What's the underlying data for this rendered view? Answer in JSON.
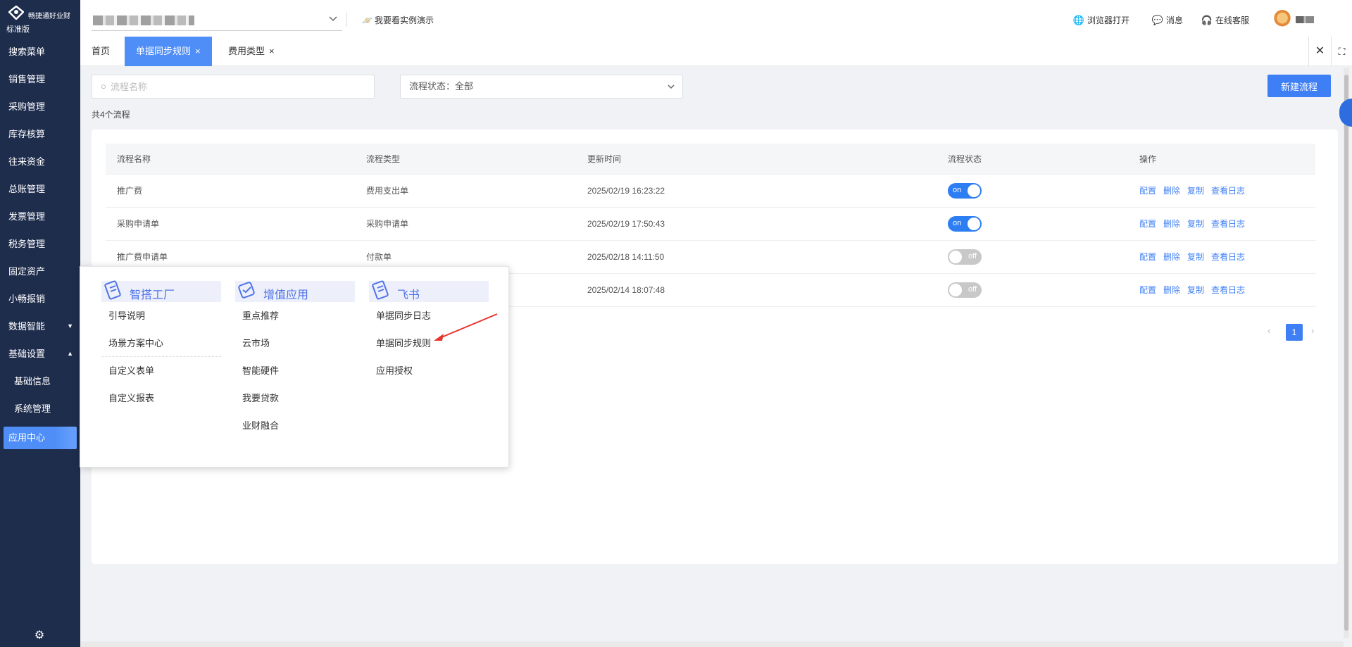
{
  "brand": {
    "name": "畅捷通好业财",
    "edition": "标准版"
  },
  "sidebar": {
    "items": [
      {
        "label": "搜索菜单"
      },
      {
        "label": "销售管理"
      },
      {
        "label": "采购管理"
      },
      {
        "label": "库存核算"
      },
      {
        "label": "往来资金"
      },
      {
        "label": "总账管理"
      },
      {
        "label": "发票管理"
      },
      {
        "label": "税务管理"
      },
      {
        "label": "固定资产"
      },
      {
        "label": "小畅报销"
      },
      {
        "label": "数据智能",
        "caret": "▼"
      },
      {
        "label": "基础设置",
        "caret": "▲"
      },
      {
        "label": "基础信息"
      },
      {
        "label": "系统管理"
      },
      {
        "label": "应用中心"
      }
    ],
    "gear_icon": "gear-icon"
  },
  "header": {
    "demo_link": "我要看实例演示",
    "browser_open": "浏览器打开",
    "messages": "消息",
    "support": "在线客服"
  },
  "tabs": {
    "items": [
      {
        "label": "首页"
      },
      {
        "label": "单据同步规则",
        "close": "×"
      },
      {
        "label": "费用类型",
        "close": "×"
      }
    ],
    "close_all": "✕",
    "fullscreen": "⛶"
  },
  "toolbar": {
    "search_placeholder": "流程名称",
    "status_filter": "流程状态：全部",
    "new_button": "新建流程",
    "count_text": "共4个流程"
  },
  "table": {
    "headers": [
      "流程名称",
      "流程类型",
      "更新时间",
      "流程状态",
      "操作"
    ],
    "rows": [
      {
        "name": "推广费",
        "type": "费用支出单",
        "time": "2025/02/19 16:23:22",
        "status": "on"
      },
      {
        "name": "采购申请单",
        "type": "采购申请单",
        "time": "2025/02/19 17:50:43",
        "status": "on"
      },
      {
        "name": "推广费申请单",
        "type": "付款单",
        "time": "2025/02/18 14:11:50",
        "status": "off"
      },
      {
        "name": "",
        "type": "",
        "time": "2025/02/14 18:07:48",
        "status": "off"
      }
    ],
    "actions": [
      "配置",
      "删除",
      "复制",
      "查看日志"
    ]
  },
  "pagination": {
    "prev": "‹",
    "current": "1",
    "next": "›"
  },
  "popup": {
    "columns": [
      {
        "title": "智搭工厂",
        "links": [
          "引导说明",
          "场景方案中心",
          "自定义表单",
          "自定义报表"
        ]
      },
      {
        "title": "增值应用",
        "links": [
          "重点推荐",
          "云市场",
          "智能硬件",
          "我要贷款",
          "业财融合"
        ]
      },
      {
        "title": "飞书",
        "links": [
          "单据同步日志",
          "单据同步规则",
          "应用授权"
        ]
      }
    ]
  },
  "colors": {
    "sidebar_bg": "#1f2d4d",
    "accent": "#3f7ff5",
    "arrow": "#e8352c"
  }
}
